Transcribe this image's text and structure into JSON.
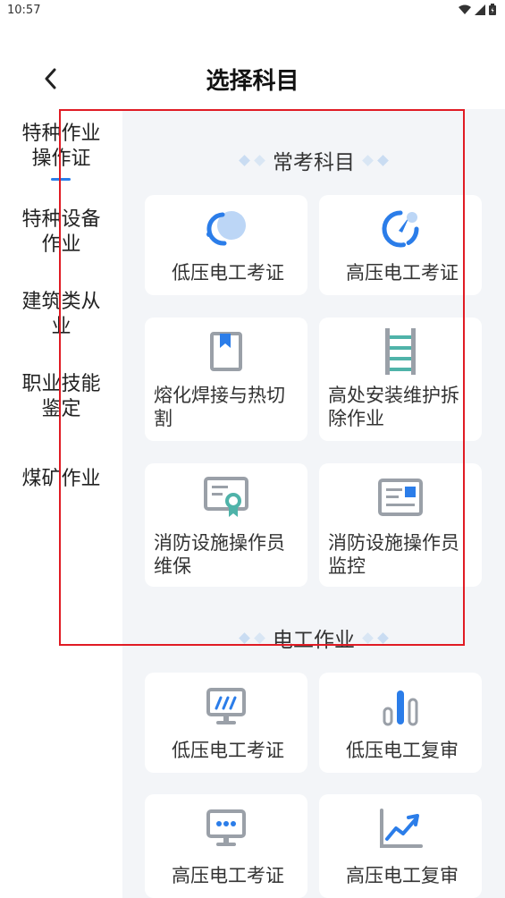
{
  "status": {
    "time": "10:57"
  },
  "header": {
    "title": "选择科目"
  },
  "sidebar": {
    "items": [
      {
        "label_line1": "特种作业",
        "label_line2": "操作证"
      },
      {
        "label_line1": "特种设备",
        "label_line2": "作业"
      },
      {
        "label_line1": "建筑类从",
        "label_line2": "业"
      },
      {
        "label_line1": "职业技能",
        "label_line2": "鉴定"
      },
      {
        "label_line1": "煤矿作业",
        "label_line2": ""
      }
    ]
  },
  "sections": [
    {
      "title": "常考科目",
      "cards": [
        {
          "label_line1": "低压电工考证",
          "label_line2": "",
          "icon": "bubble-ring-icon"
        },
        {
          "label_line1": "高压电工考证",
          "label_line2": "",
          "icon": "gauge-icon"
        },
        {
          "label_line1": "熔化焊接与热切",
          "label_line2": "割",
          "icon": "book-icon"
        },
        {
          "label_line1": "高处安装维护拆",
          "label_line2": "除作业",
          "icon": "ladder-icon"
        },
        {
          "label_line1": "消防设施操作员",
          "label_line2": "维保",
          "icon": "certificate-icon"
        },
        {
          "label_line1": "消防设施操作员",
          "label_line2": "监控",
          "icon": "id-card-icon"
        }
      ]
    },
    {
      "title": "电工作业",
      "cards": [
        {
          "label_line1": "低压电工考证",
          "label_line2": "",
          "icon": "monitor-icon"
        },
        {
          "label_line1": "低压电工复审",
          "label_line2": "",
          "icon": "bar-chart-icon"
        },
        {
          "label_line1": "高压电工考证",
          "label_line2": "",
          "icon": "monitor-chat-icon"
        },
        {
          "label_line1": "高压电工复审",
          "label_line2": "",
          "icon": "trend-chart-icon"
        }
      ]
    }
  ],
  "colors": {
    "accent": "#2b7de9",
    "highlight": "#e01b24",
    "icon_gray": "#9aa0a8",
    "icon_teal": "#4fb3a9"
  }
}
